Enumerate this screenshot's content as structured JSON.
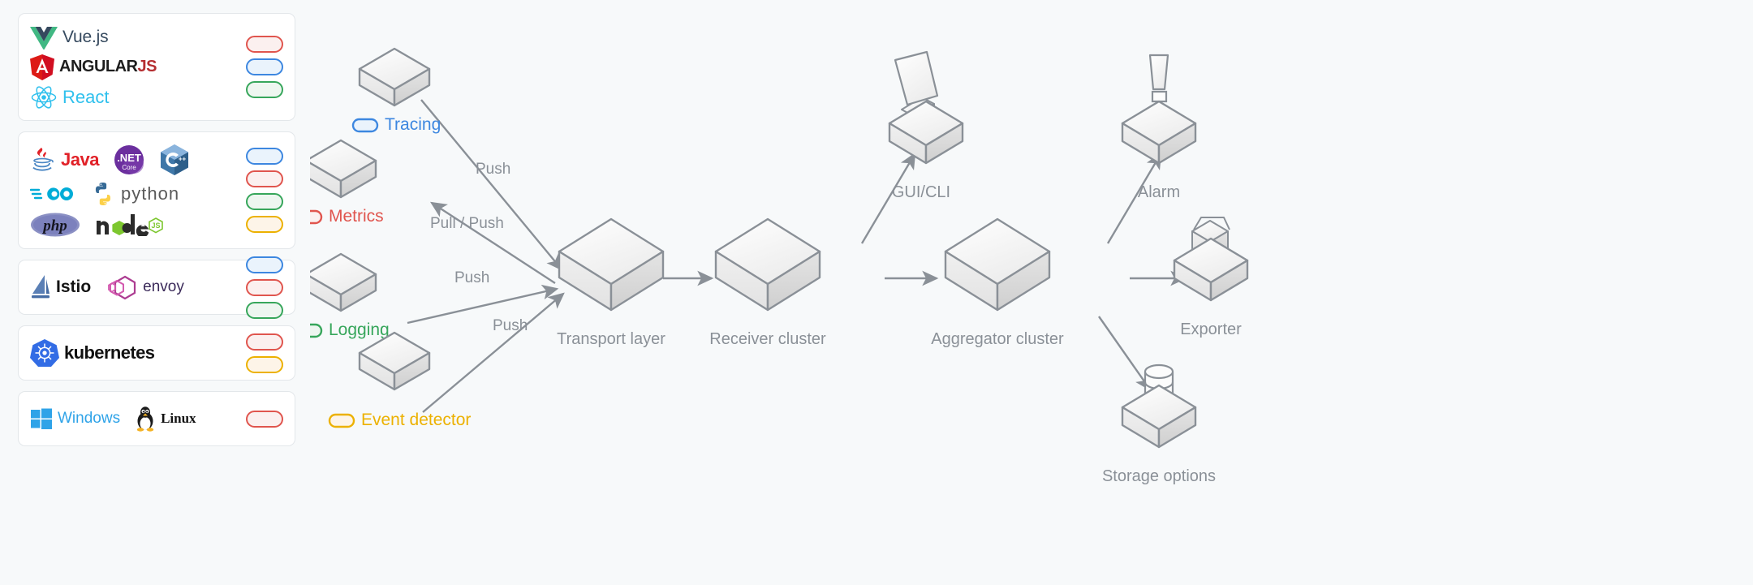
{
  "sidebar": {
    "cards": [
      {
        "id": "frontend",
        "name": "frontend-frameworks",
        "logos": [
          {
            "name": "vuejs-logo",
            "label": "Vue.js"
          },
          {
            "name": "angularjs-logo",
            "label": "ANGULAR",
            "label_suffix": "JS"
          },
          {
            "name": "react-logo",
            "label": "React"
          }
        ],
        "pills": [
          "red",
          "blue",
          "green"
        ]
      },
      {
        "id": "languages",
        "name": "backend-languages",
        "logos": [
          {
            "name": "java-logo",
            "label": "Java"
          },
          {
            "name": "dotnet-core-logo",
            "label": ".NET",
            "sublabel": "Core"
          },
          {
            "name": "cplusplus-logo",
            "label": "C++"
          },
          {
            "name": "go-logo",
            "label": "GO"
          },
          {
            "name": "python-logo",
            "label": "python"
          },
          {
            "name": "php-logo",
            "label": "php"
          },
          {
            "name": "nodejs-logo",
            "label": "node"
          }
        ],
        "pills": [
          "blue",
          "red",
          "green",
          "yellow"
        ]
      },
      {
        "id": "mesh",
        "name": "service-mesh",
        "logos": [
          {
            "name": "istio-logo",
            "label": "Istio"
          },
          {
            "name": "envoy-logo",
            "label": "envoy"
          }
        ],
        "pills": [
          "blue",
          "red",
          "green"
        ]
      },
      {
        "id": "orchestration",
        "name": "orchestration",
        "logos": [
          {
            "name": "kubernetes-logo",
            "label": "kubernetes"
          }
        ],
        "pills": [
          "red",
          "yellow"
        ]
      },
      {
        "id": "os",
        "name": "operating-systems",
        "logos": [
          {
            "name": "windows-logo",
            "label": "Windows"
          },
          {
            "name": "linux-logo",
            "label": "Linux"
          }
        ],
        "pills": [
          "red"
        ]
      }
    ],
    "pill_colors": {
      "red": "#e0554e",
      "blue": "#3d87e0",
      "green": "#37a65b",
      "yellow": "#ecb100"
    }
  },
  "diagram": {
    "sources": [
      {
        "id": "tracing",
        "label": "Tracing",
        "color_key": "blue",
        "color": "#3d87e0"
      },
      {
        "id": "metrics",
        "label": "Metrics",
        "color_key": "red",
        "color": "#e0554e"
      },
      {
        "id": "logging",
        "label": "Logging",
        "color_key": "green",
        "color": "#37a65b"
      },
      {
        "id": "event_detector",
        "label": "Event detector",
        "color_key": "yellow",
        "color": "#ecb100"
      }
    ],
    "pipeline": [
      {
        "id": "transport_layer",
        "label": "Transport layer"
      },
      {
        "id": "receiver_cluster",
        "label": "Receiver cluster"
      },
      {
        "id": "aggregator_cluster",
        "label": "Aggregator cluster"
      }
    ],
    "outputs": [
      {
        "id": "gui_cli",
        "label": "GUI/CLI",
        "icon": "monitor-on-box-icon"
      },
      {
        "id": "alarm",
        "label": "Alarm",
        "icon": "horn-on-box-icon"
      },
      {
        "id": "exporter",
        "label": "Exporter",
        "icon": "open-box-on-box-icon"
      },
      {
        "id": "storage_options",
        "label": "Storage options",
        "icon": "database-on-box-icon"
      }
    ],
    "edge_labels": {
      "tracing_to_transport": "Push",
      "metrics_to_transport": "Pull / Push",
      "logging_to_transport": "Push",
      "event_to_transport": "Push"
    },
    "colors": {
      "node_stroke": "#8a9097",
      "node_top": "#fbfbfb",
      "node_side": "#e6e6e6",
      "label_text": "#8a9097",
      "canvas_bg": "#f7f9fa"
    }
  }
}
